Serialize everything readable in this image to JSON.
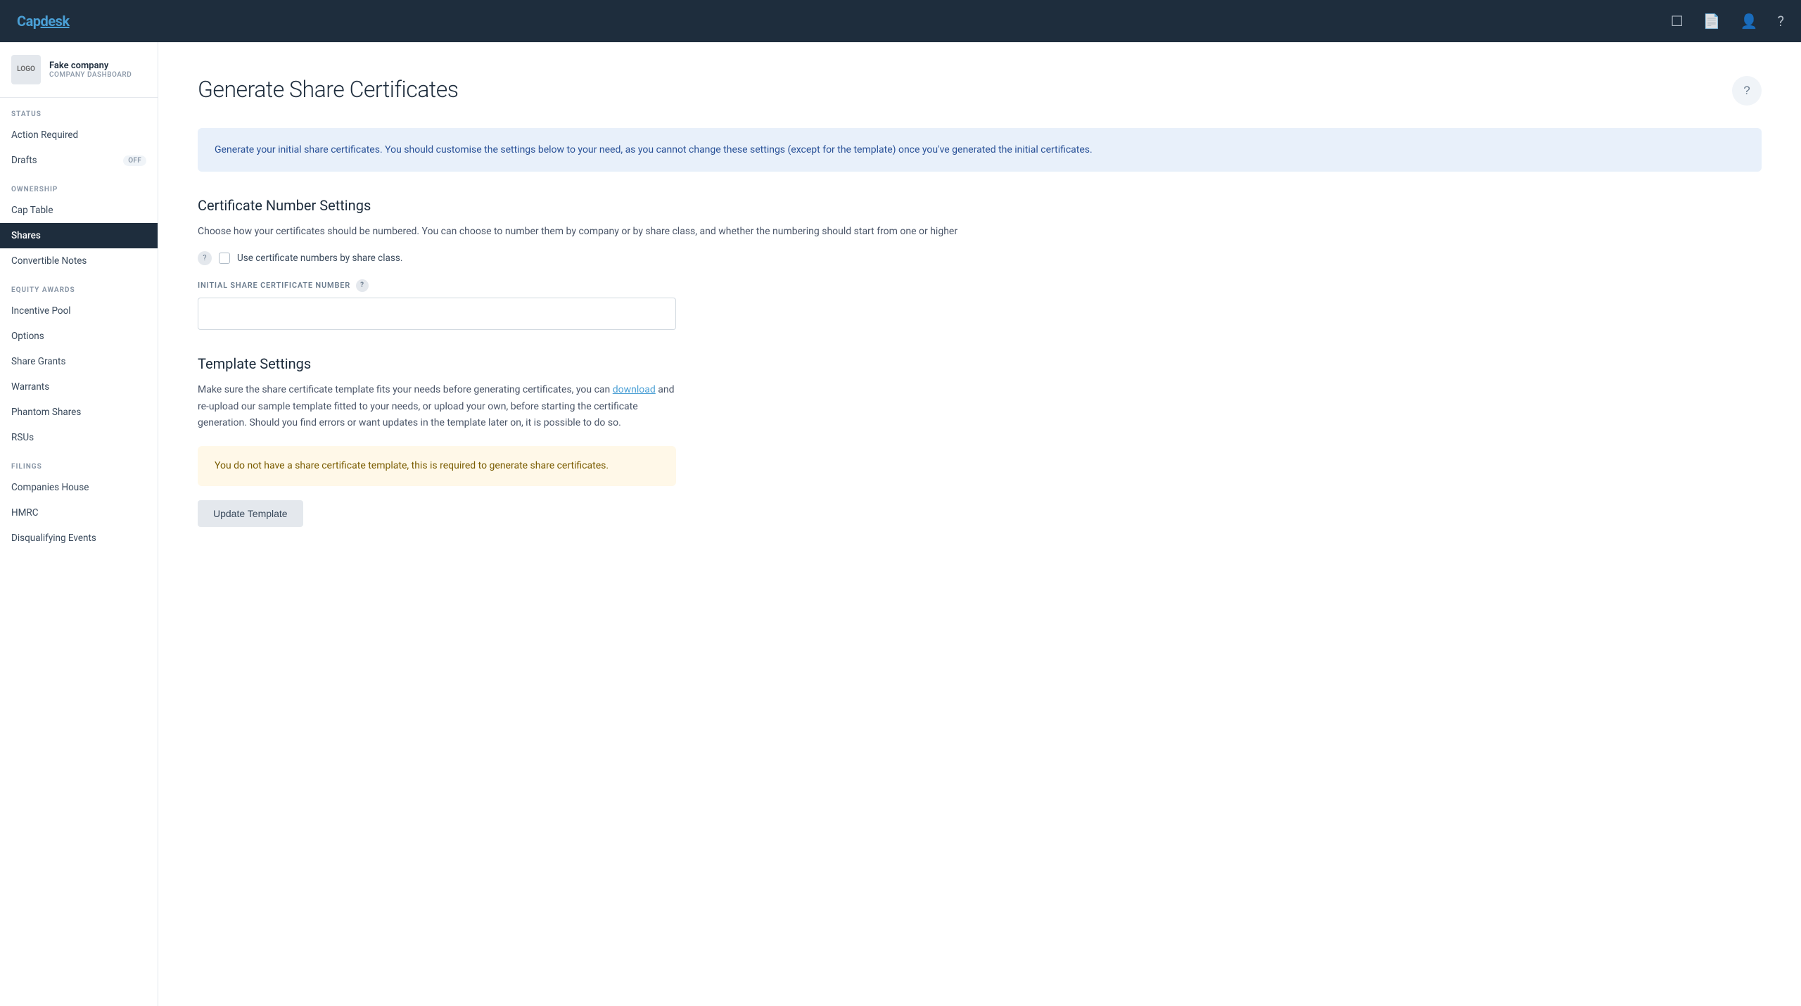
{
  "brand": {
    "name_part1": "Cap",
    "name_part2": "desk"
  },
  "navbar": {
    "icons": [
      "check-square-icon",
      "document-icon",
      "user-icon",
      "question-icon"
    ]
  },
  "sidebar": {
    "company_name": "Fake company",
    "company_sub": "COMPANY DASHBOARD",
    "company_logo_text": "LOGO",
    "sections": [
      {
        "label": "STATUS",
        "items": [
          {
            "id": "action-required",
            "label": "Action Required",
            "badge": null,
            "active": false
          },
          {
            "id": "drafts",
            "label": "Drafts",
            "badge": "OFF",
            "active": false
          }
        ]
      },
      {
        "label": "OWNERSHIP",
        "items": [
          {
            "id": "cap-table",
            "label": "Cap Table",
            "badge": null,
            "active": false
          },
          {
            "id": "shares",
            "label": "Shares",
            "badge": null,
            "active": true
          },
          {
            "id": "convertible-notes",
            "label": "Convertible Notes",
            "badge": null,
            "active": false
          }
        ]
      },
      {
        "label": "EQUITY AWARDS",
        "items": [
          {
            "id": "incentive-pool",
            "label": "Incentive Pool",
            "badge": null,
            "active": false
          },
          {
            "id": "options",
            "label": "Options",
            "badge": null,
            "active": false
          },
          {
            "id": "share-grants",
            "label": "Share Grants",
            "badge": null,
            "active": false
          },
          {
            "id": "warrants",
            "label": "Warrants",
            "badge": null,
            "active": false
          },
          {
            "id": "phantom-shares",
            "label": "Phantom Shares",
            "badge": null,
            "active": false
          },
          {
            "id": "rsus",
            "label": "RSUs",
            "badge": null,
            "active": false
          }
        ]
      },
      {
        "label": "FILINGS",
        "items": [
          {
            "id": "companies-house",
            "label": "Companies House",
            "badge": null,
            "active": false
          },
          {
            "id": "hmrc",
            "label": "HMRC",
            "badge": null,
            "active": false
          },
          {
            "id": "disqualifying-events",
            "label": "Disqualifying Events",
            "badge": null,
            "active": false
          }
        ]
      }
    ]
  },
  "main": {
    "page_title": "Generate Share Certificates",
    "info_banner": "Generate your initial share certificates. You should customise the settings below to your need, as you cannot change these settings (except for the template) once you've generated the initial certificates.",
    "cert_number_section": {
      "title": "Certificate Number Settings",
      "description": "Choose how your certificates should be numbered. You can choose to number them by company or by share class, and whether the numbering should start from one or higher",
      "checkbox_label": "Use certificate numbers by share class.",
      "field_label": "INITIAL SHARE CERTIFICATE NUMBER",
      "field_value": ""
    },
    "template_section": {
      "title": "Template Settings",
      "description_part1": "Make sure the share certificate template fits your needs before generating certificates, you can ",
      "download_link": "download",
      "description_part2": " and re-upload our sample template fitted to your needs, or upload your own, before starting the certificate generation. Should you find errors or want updates in the template later on, it is possible to do so.",
      "warning": "You do not have a share certificate template, this is required to generate share certificates.",
      "update_button": "Update Template"
    }
  }
}
